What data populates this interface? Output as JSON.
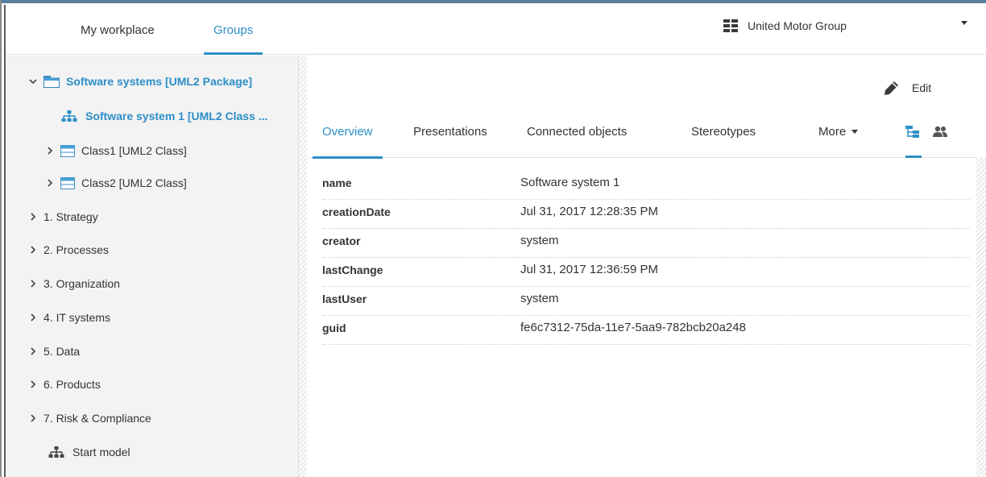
{
  "header": {
    "nav_tabs": [
      {
        "label": "My workplace"
      },
      {
        "label": "Groups"
      }
    ],
    "database": "United Motor Group"
  },
  "sidebar": {
    "items": [
      {
        "label": "Software systems [UML2 Package]"
      },
      {
        "label": "Software system 1 [UML2 Class ..."
      },
      {
        "label": "Class1 [UML2 Class]"
      },
      {
        "label": "Class2 [UML2 Class]"
      },
      {
        "label": "1. Strategy"
      },
      {
        "label": "2. Processes"
      },
      {
        "label": "3. Organization"
      },
      {
        "label": "4. IT systems"
      },
      {
        "label": "5. Data"
      },
      {
        "label": "6. Products"
      },
      {
        "label": "7. Risk & Compliance"
      },
      {
        "label": "Start model"
      }
    ]
  },
  "toolbar": {
    "edit_label": "Edit"
  },
  "tabs": [
    {
      "label": "Overview"
    },
    {
      "label": "Presentations"
    },
    {
      "label": "Connected objects"
    },
    {
      "label": "Stereotypes"
    },
    {
      "label": "More"
    }
  ],
  "attributes": [
    {
      "key": "name",
      "value": "Software system 1"
    },
    {
      "key": "creationDate",
      "value": "Jul 31, 2017 12:28:35 PM"
    },
    {
      "key": "creator",
      "value": "system"
    },
    {
      "key": "lastChange",
      "value": "Jul 31, 2017 12:36:59 PM"
    },
    {
      "key": "lastUser",
      "value": "system"
    },
    {
      "key": "guid",
      "value": "fe6c7312-75da-11e7-5aa9-782bcb20a248"
    }
  ],
  "colors": {
    "accent": "#2c8ec7",
    "sidebar_bg": "#f3f3f3",
    "class_icon": "#4a9fd4"
  },
  "icons": {
    "database": "database-icon",
    "edit": "pencil-icon",
    "package": "folder-icon",
    "class": "class-icon",
    "model": "hierarchy-icon",
    "view_tree": "tree-view-icon",
    "view_users": "users-icon"
  }
}
